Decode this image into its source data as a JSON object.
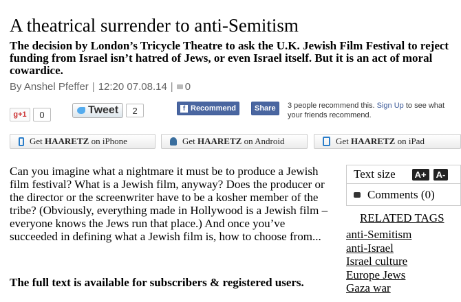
{
  "article": {
    "title": "A theatrical surrender to anti-Semitism",
    "subtitle": "The decision by London’s Tricycle Theatre to ask the U.K. Jewish Film Festival to reject funding from Israel isn’t hatred of Jews, or even Israel itself. But it is an act of moral cowardice.",
    "author": "By Anshel Pfeffer",
    "separator": "|",
    "timestamp": "12:20 07.08.14",
    "comment_count": "0",
    "body": "Can you imagine what a nightmare it must be to produce a Jewish film festival? What is a Jewish film, anyway? Does the producer or the director or the screenwriter have to be a kosher member of the tribe? (Obviously, everything made in Hollywood is a Jewish film – everyone knows the Jews run that place.) And once you’ve succeeded in defining what a Jewish film is, how to choose from...",
    "subscriber_note": "The full text is available for subscribers & registered users."
  },
  "social": {
    "gplus_label": "g+1",
    "gplus_count": "0",
    "tweet_label": "Tweet",
    "tweet_count": "2",
    "fb_recommend_label": "Recommend",
    "fb_share_label": "Share",
    "fb_text": "3 people recommend this.",
    "fb_signup": "Sign Up",
    "fb_text_tail": "to see what your friends recommend."
  },
  "apps": [
    {
      "prefix": "Get ",
      "brand": "HAARETZ",
      "suffix": " on iPhone",
      "icon": "phone-icon"
    },
    {
      "prefix": "Get ",
      "brand": "HAARETZ",
      "suffix": " on Android",
      "icon": "android-icon"
    },
    {
      "prefix": "Get ",
      "brand": "HAARETZ",
      "suffix": " on iPad",
      "icon": "tablet-icon"
    }
  ],
  "sidebar": {
    "text_size_label": "Text size",
    "increase_label": "A+",
    "decrease_label": "A-",
    "comments_label": "Comments (0)",
    "related_heading": "Related tags",
    "tags": [
      "anti-Semitism",
      "anti-Israel",
      "Israel culture",
      "Europe Jews",
      "Gaza war"
    ]
  },
  "colors": {
    "facebook_blue": "#4a66a0",
    "twitter_blue": "#55acee",
    "byline_gray": "#666666"
  }
}
